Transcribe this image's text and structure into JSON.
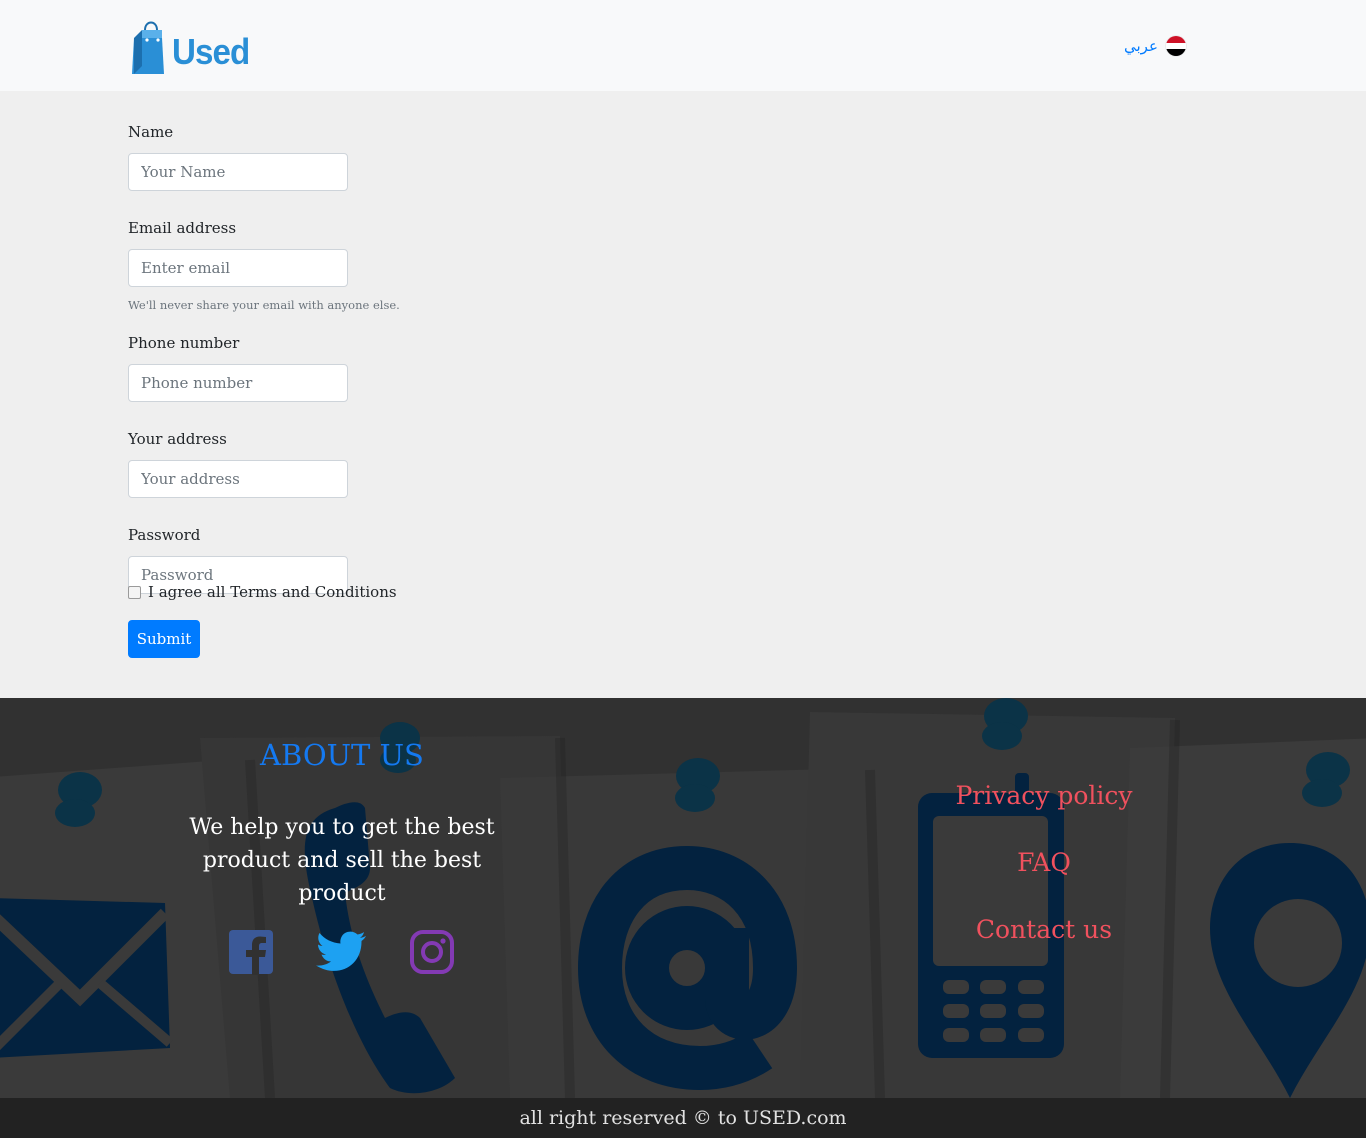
{
  "header": {
    "logo_text": "Used",
    "language_label": "عربي",
    "flag_colors": [
      "#ce1126",
      "#ffffff",
      "#000000"
    ]
  },
  "form": {
    "fields": [
      {
        "label": "Name",
        "placeholder": "Your Name"
      },
      {
        "label": "Email address",
        "placeholder": "Enter email",
        "hint": "We'll never share your email with anyone else."
      },
      {
        "label": "Phone number",
        "placeholder": "Phone number"
      },
      {
        "label": "Your address",
        "placeholder": "Your address"
      },
      {
        "label": "Password",
        "placeholder": "Password"
      }
    ],
    "terms_label": "I agree all Terms and Conditions",
    "submit_label": "Submit"
  },
  "footer": {
    "about_title": "ABOUT US",
    "about_text": "We help you to get the best product and sell the best product",
    "social": [
      {
        "name": "facebook-icon",
        "color": "#3b5998"
      },
      {
        "name": "twitter-icon",
        "color": "#1da1f2"
      },
      {
        "name": "instagram-icon",
        "color": "#833ab4"
      }
    ],
    "links": [
      "Privacy policy",
      "FAQ",
      "Contact us"
    ],
    "copyright": "all right reserved © to USED.com"
  },
  "colors": {
    "primary": "#007bff",
    "link_red": "#f0515e",
    "about_blue": "#1479f1",
    "icon_navy": "#03223f"
  }
}
